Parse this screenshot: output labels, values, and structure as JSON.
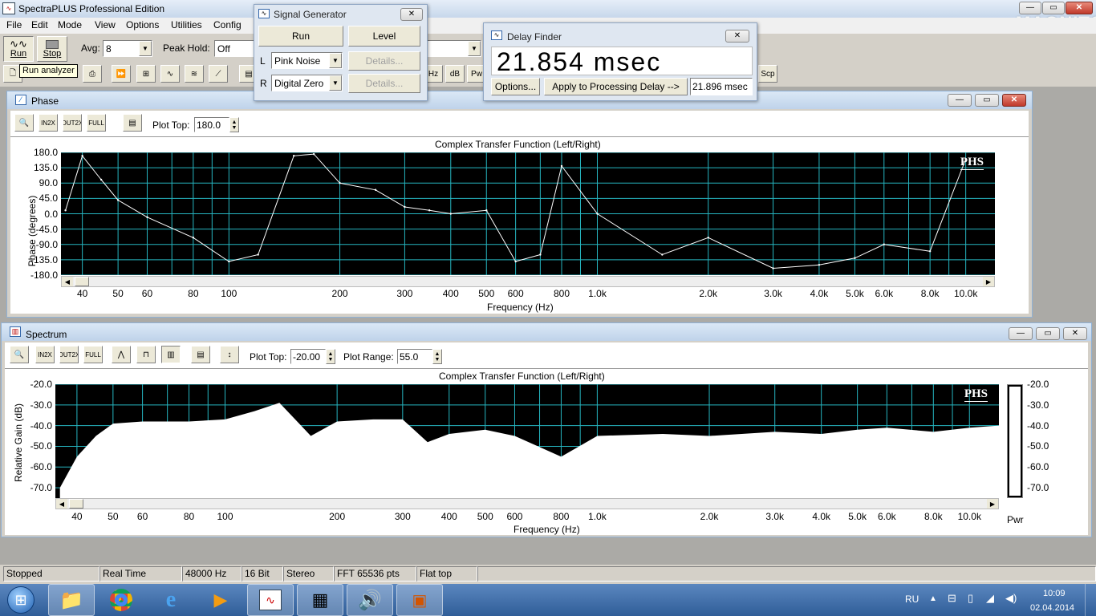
{
  "app": {
    "title": "SpectraPLUS Professional Edition"
  },
  "menu": [
    "File",
    "Edit",
    "Mode",
    "View",
    "Options",
    "Utilities",
    "Config"
  ],
  "toolbar": {
    "run_label": "Run",
    "stop_label": "Stop",
    "avg_label": "Avg:",
    "avg_value": "8",
    "peak_hold_label": "Peak Hold:",
    "peak_hold_value": "Off",
    "tooltip": "Run analyzer",
    "hz_btn": "Hz",
    "db_btn": "dB",
    "pw_btn": "Pw",
    "scp_btn": "Scp"
  },
  "signal_generator": {
    "title": "Signal Generator",
    "run_label": "Run",
    "level_label": "Level",
    "left_label": "L",
    "right_label": "R",
    "left_value": "Pink Noise",
    "right_value": "Digital Zero",
    "details_label": "Details..."
  },
  "delay_finder": {
    "title": "Delay Finder",
    "delay_value": "21.854 msec",
    "options_label": "Options...",
    "apply_label": "Apply to Processing Delay -->",
    "applied_value": "21.896 msec"
  },
  "phase": {
    "title": "Phase",
    "plot_top_label": "Plot Top:",
    "plot_top_value": "180.0",
    "plot_title": "Complex Transfer Function (Left/Right)",
    "badge": "PHS",
    "ylabel": "Phase (degrees)",
    "xlabel": "Frequency (Hz)",
    "yticks": [
      "180.0",
      "135.0",
      "90.0",
      "45.0",
      "0.0",
      "-45.0",
      "-90.0",
      "-135.0",
      "-180.0"
    ],
    "xticks": [
      "40",
      "50",
      "60",
      "80",
      "100",
      "200",
      "300",
      "400",
      "500",
      "600",
      "800",
      "1.0k",
      "2.0k",
      "3.0k",
      "4.0k",
      "5.0k",
      "6.0k",
      "8.0k",
      "10.0k"
    ]
  },
  "spectrum": {
    "title": "Spectrum",
    "plot_top_label": "Plot Top:",
    "plot_top_value": "-20.00",
    "plot_range_label": "Plot Range:",
    "plot_range_value": "55.0",
    "plot_title": "Complex Transfer Function (Left/Right)",
    "badge": "PHS",
    "ylabel": "Relative Gain (dB)",
    "xlabel": "Frequency (Hz)",
    "yticks": [
      "-20.0",
      "-30.0",
      "-40.0",
      "-50.0",
      "-60.0",
      "-70.0"
    ],
    "xticks": [
      "40",
      "50",
      "60",
      "80",
      "100",
      "200",
      "300",
      "400",
      "500",
      "600",
      "800",
      "1.0k",
      "2.0k",
      "3.0k",
      "4.0k",
      "5.0k",
      "6.0k",
      "8.0k",
      "10.0k"
    ],
    "pwr_label": "Pwr"
  },
  "status": [
    "Stopped",
    "Real Time",
    "48000 Hz",
    "16 Bit",
    "Stereo",
    "FFT 65536 pts",
    "Flat top"
  ],
  "taskbar": {
    "lang": "RU",
    "time": "10:09",
    "date": "02.04.2014"
  },
  "watermark": "MAGNITOLA",
  "colors": {
    "grid": "#26b5c0",
    "plot_bg": "#000000",
    "trace": "#ffffff",
    "title_bar": "#c9d9ee",
    "taskbar": "#3a6aa5"
  },
  "chart_data": [
    {
      "type": "line",
      "title": "Complex Transfer Function (Left/Right)",
      "xlabel": "Frequency (Hz)",
      "ylabel": "Phase (degrees)",
      "xscale": "log",
      "ylim": [
        -180,
        180
      ],
      "xlim": [
        35,
        12000
      ],
      "x": [
        36,
        40,
        45,
        50,
        60,
        80,
        100,
        120,
        150,
        170,
        200,
        250,
        300,
        350,
        400,
        500,
        600,
        700,
        800,
        1000,
        1500,
        2000,
        3000,
        4000,
        5000,
        6000,
        8000,
        10000
      ],
      "y": [
        10,
        170,
        100,
        40,
        -10,
        -70,
        -140,
        -120,
        170,
        175,
        90,
        70,
        20,
        10,
        0,
        10,
        -140,
        -120,
        140,
        0,
        -120,
        -70,
        -160,
        -150,
        -130,
        -90,
        -110,
        160
      ]
    },
    {
      "type": "area",
      "title": "Complex Transfer Function (Left/Right)",
      "xlabel": "Frequency (Hz)",
      "ylabel": "Relative Gain (dB)",
      "xscale": "log",
      "ylim": [
        -75,
        -20
      ],
      "xlim": [
        35,
        12000
      ],
      "x": [
        36,
        40,
        45,
        50,
        60,
        80,
        100,
        120,
        140,
        170,
        200,
        250,
        300,
        350,
        400,
        500,
        600,
        800,
        1000,
        1500,
        2000,
        3000,
        4000,
        5000,
        6000,
        8000,
        10000,
        12000
      ],
      "y": [
        -70,
        -55,
        -45,
        -39,
        -38,
        -38,
        -37,
        -33,
        -29,
        -45,
        -38,
        -37,
        -37,
        -48,
        -44,
        -42,
        -45,
        -55,
        -45,
        -44,
        -45,
        -43,
        -44,
        -42,
        -41,
        -43,
        -41,
        -40
      ]
    }
  ]
}
